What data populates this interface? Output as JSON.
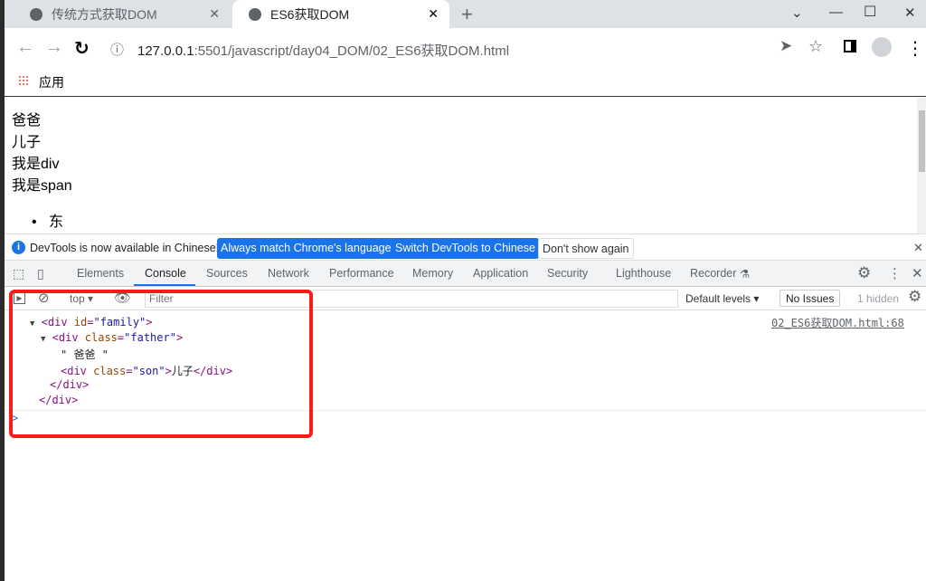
{
  "browser": {
    "tabs": [
      {
        "title": "传统方式获取DOM",
        "active": false
      },
      {
        "title": "ES6获取DOM",
        "active": true
      }
    ],
    "url_host": "127.0.0.1",
    "url_rest": ":5501/javascript/day04_DOM/02_ES6获取DOM.html",
    "bookmark": "应用"
  },
  "page": {
    "lines": [
      "爸爸",
      "儿子",
      "我是div",
      "我是span"
    ],
    "list": [
      "东"
    ]
  },
  "infobar": {
    "message": "DevTools is now available in Chinese!",
    "btn1": "Always match Chrome's language",
    "btn2": "Switch DevTools to Chinese",
    "btn3": "Don't show again"
  },
  "devtools": {
    "tabs": [
      "Elements",
      "Console",
      "Sources",
      "Network",
      "Performance",
      "Memory",
      "Application",
      "Security",
      "Lighthouse",
      "Recorder"
    ],
    "active_tab": "Console",
    "context": "top",
    "filter_placeholder": "Filter",
    "levels": "Default levels",
    "issues": "No Issues",
    "hidden": "1 hidden"
  },
  "console": {
    "source": "02_ES6获取DOM.html:68",
    "l1": {
      "t1": "<div ",
      "a": "id",
      "eq": "=",
      "v": "\"family\"",
      "t2": ">"
    },
    "l2": {
      "t1": "<div ",
      "a": "class",
      "eq": "=",
      "v": "\"father\"",
      "t2": ">"
    },
    "l3": "\" 爸爸 \"",
    "l4": {
      "t1": "<div ",
      "a": "class",
      "eq": "=",
      "v": "\"son\"",
      "t2": ">",
      "text": "儿子",
      "t3": "</div>"
    },
    "l5": "</div>",
    "l6": "</div>",
    "prompt": ">"
  }
}
